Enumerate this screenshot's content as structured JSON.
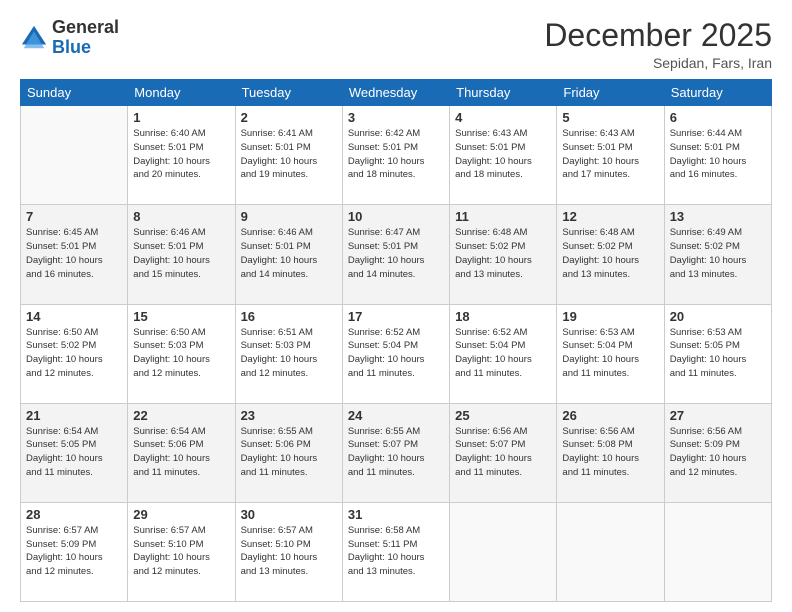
{
  "logo": {
    "line1": "General",
    "line2": "Blue"
  },
  "title": "December 2025",
  "subtitle": "Sepidan, Fars, Iran",
  "weekdays": [
    "Sunday",
    "Monday",
    "Tuesday",
    "Wednesday",
    "Thursday",
    "Friday",
    "Saturday"
  ],
  "rows": [
    [
      {
        "day": "",
        "info": ""
      },
      {
        "day": "1",
        "info": "Sunrise: 6:40 AM\nSunset: 5:01 PM\nDaylight: 10 hours\nand 20 minutes."
      },
      {
        "day": "2",
        "info": "Sunrise: 6:41 AM\nSunset: 5:01 PM\nDaylight: 10 hours\nand 19 minutes."
      },
      {
        "day": "3",
        "info": "Sunrise: 6:42 AM\nSunset: 5:01 PM\nDaylight: 10 hours\nand 18 minutes."
      },
      {
        "day": "4",
        "info": "Sunrise: 6:43 AM\nSunset: 5:01 PM\nDaylight: 10 hours\nand 18 minutes."
      },
      {
        "day": "5",
        "info": "Sunrise: 6:43 AM\nSunset: 5:01 PM\nDaylight: 10 hours\nand 17 minutes."
      },
      {
        "day": "6",
        "info": "Sunrise: 6:44 AM\nSunset: 5:01 PM\nDaylight: 10 hours\nand 16 minutes."
      }
    ],
    [
      {
        "day": "7",
        "info": "Sunrise: 6:45 AM\nSunset: 5:01 PM\nDaylight: 10 hours\nand 16 minutes."
      },
      {
        "day": "8",
        "info": "Sunrise: 6:46 AM\nSunset: 5:01 PM\nDaylight: 10 hours\nand 15 minutes."
      },
      {
        "day": "9",
        "info": "Sunrise: 6:46 AM\nSunset: 5:01 PM\nDaylight: 10 hours\nand 14 minutes."
      },
      {
        "day": "10",
        "info": "Sunrise: 6:47 AM\nSunset: 5:01 PM\nDaylight: 10 hours\nand 14 minutes."
      },
      {
        "day": "11",
        "info": "Sunrise: 6:48 AM\nSunset: 5:02 PM\nDaylight: 10 hours\nand 13 minutes."
      },
      {
        "day": "12",
        "info": "Sunrise: 6:48 AM\nSunset: 5:02 PM\nDaylight: 10 hours\nand 13 minutes."
      },
      {
        "day": "13",
        "info": "Sunrise: 6:49 AM\nSunset: 5:02 PM\nDaylight: 10 hours\nand 13 minutes."
      }
    ],
    [
      {
        "day": "14",
        "info": "Sunrise: 6:50 AM\nSunset: 5:02 PM\nDaylight: 10 hours\nand 12 minutes."
      },
      {
        "day": "15",
        "info": "Sunrise: 6:50 AM\nSunset: 5:03 PM\nDaylight: 10 hours\nand 12 minutes."
      },
      {
        "day": "16",
        "info": "Sunrise: 6:51 AM\nSunset: 5:03 PM\nDaylight: 10 hours\nand 12 minutes."
      },
      {
        "day": "17",
        "info": "Sunrise: 6:52 AM\nSunset: 5:04 PM\nDaylight: 10 hours\nand 11 minutes."
      },
      {
        "day": "18",
        "info": "Sunrise: 6:52 AM\nSunset: 5:04 PM\nDaylight: 10 hours\nand 11 minutes."
      },
      {
        "day": "19",
        "info": "Sunrise: 6:53 AM\nSunset: 5:04 PM\nDaylight: 10 hours\nand 11 minutes."
      },
      {
        "day": "20",
        "info": "Sunrise: 6:53 AM\nSunset: 5:05 PM\nDaylight: 10 hours\nand 11 minutes."
      }
    ],
    [
      {
        "day": "21",
        "info": "Sunrise: 6:54 AM\nSunset: 5:05 PM\nDaylight: 10 hours\nand 11 minutes."
      },
      {
        "day": "22",
        "info": "Sunrise: 6:54 AM\nSunset: 5:06 PM\nDaylight: 10 hours\nand 11 minutes."
      },
      {
        "day": "23",
        "info": "Sunrise: 6:55 AM\nSunset: 5:06 PM\nDaylight: 10 hours\nand 11 minutes."
      },
      {
        "day": "24",
        "info": "Sunrise: 6:55 AM\nSunset: 5:07 PM\nDaylight: 10 hours\nand 11 minutes."
      },
      {
        "day": "25",
        "info": "Sunrise: 6:56 AM\nSunset: 5:07 PM\nDaylight: 10 hours\nand 11 minutes."
      },
      {
        "day": "26",
        "info": "Sunrise: 6:56 AM\nSunset: 5:08 PM\nDaylight: 10 hours\nand 11 minutes."
      },
      {
        "day": "27",
        "info": "Sunrise: 6:56 AM\nSunset: 5:09 PM\nDaylight: 10 hours\nand 12 minutes."
      }
    ],
    [
      {
        "day": "28",
        "info": "Sunrise: 6:57 AM\nSunset: 5:09 PM\nDaylight: 10 hours\nand 12 minutes."
      },
      {
        "day": "29",
        "info": "Sunrise: 6:57 AM\nSunset: 5:10 PM\nDaylight: 10 hours\nand 12 minutes."
      },
      {
        "day": "30",
        "info": "Sunrise: 6:57 AM\nSunset: 5:10 PM\nDaylight: 10 hours\nand 13 minutes."
      },
      {
        "day": "31",
        "info": "Sunrise: 6:58 AM\nSunset: 5:11 PM\nDaylight: 10 hours\nand 13 minutes."
      },
      {
        "day": "",
        "info": ""
      },
      {
        "day": "",
        "info": ""
      },
      {
        "day": "",
        "info": ""
      }
    ]
  ]
}
